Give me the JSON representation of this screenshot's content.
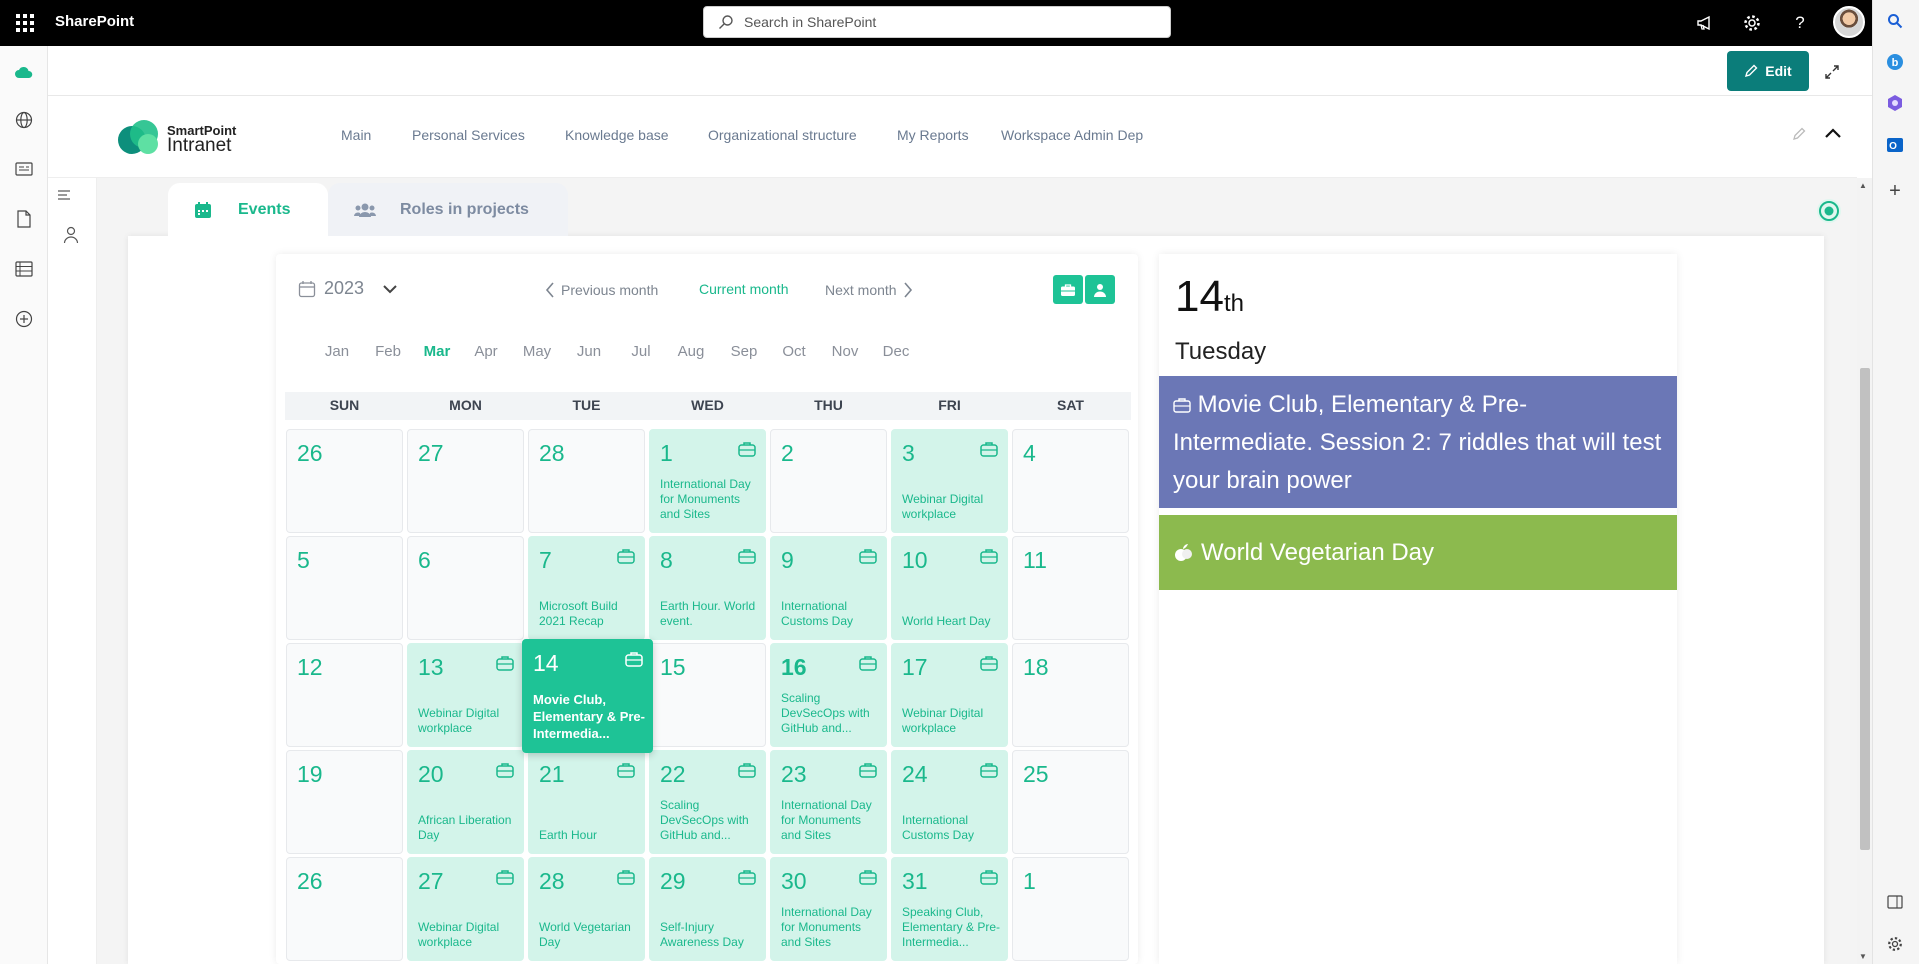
{
  "suitebar": {
    "brand": "SharePoint",
    "search_placeholder": "Search in SharePoint"
  },
  "command": {
    "edit_label": "Edit"
  },
  "nav": {
    "items": [
      "Main",
      "Personal Services",
      "Knowledge base",
      "Organizational structure",
      "My Reports",
      "Workspace Admin Dep"
    ]
  },
  "logo": {
    "line1": "SmartPoint",
    "line2": "Intranet"
  },
  "tabs": [
    {
      "label": "Events",
      "active": true
    },
    {
      "label": "Roles in projects",
      "active": false
    }
  ],
  "calendar": {
    "year": "2023",
    "prev_label": "Previous month",
    "current_label": "Current month",
    "next_label": "Next month",
    "months": [
      "Jan",
      "Feb",
      "Mar",
      "Apr",
      "May",
      "Jun",
      "Jul",
      "Aug",
      "Sep",
      "Oct",
      "Nov",
      "Dec"
    ],
    "selected_month": "Mar",
    "weekdays": [
      "SUN",
      "MON",
      "TUE",
      "WED",
      "THU",
      "FRI",
      "SAT"
    ],
    "weeks": [
      [
        {
          "day": "26",
          "event": ""
        },
        {
          "day": "27",
          "event": ""
        },
        {
          "day": "28",
          "event": ""
        },
        {
          "day": "1",
          "event": "International Day for Monuments and Sites"
        },
        {
          "day": "2",
          "event": ""
        },
        {
          "day": "3",
          "event": "Webinar Digital workplace"
        },
        {
          "day": "4",
          "event": ""
        }
      ],
      [
        {
          "day": "5",
          "event": ""
        },
        {
          "day": "6",
          "event": ""
        },
        {
          "day": "7",
          "event": "Microsoft Build 2021 Recap"
        },
        {
          "day": "8",
          "event": "Earth Hour. World event."
        },
        {
          "day": "9",
          "event": "International Customs Day"
        },
        {
          "day": "10",
          "event": "World Heart Day"
        },
        {
          "day": "11",
          "event": ""
        }
      ],
      [
        {
          "day": "12",
          "event": ""
        },
        {
          "day": "13",
          "event": "Webinar Digital workplace"
        },
        {
          "day": "14",
          "event": "Movie Club, Elementary & Pre-Intermedia...",
          "selected": true
        },
        {
          "day": "15",
          "event": ""
        },
        {
          "day": "16",
          "event": "Scaling DevSecOps with GitHub and...",
          "bold": true
        },
        {
          "day": "17",
          "event": "Webinar Digital workplace"
        },
        {
          "day": "18",
          "event": ""
        }
      ],
      [
        {
          "day": "19",
          "event": ""
        },
        {
          "day": "20",
          "event": "African Liberation Day"
        },
        {
          "day": "21",
          "event": "Earth Hour"
        },
        {
          "day": "22",
          "event": "Scaling DevSecOps with GitHub and..."
        },
        {
          "day": "23",
          "event": "International Day for Monuments and Sites"
        },
        {
          "day": "24",
          "event": "International Customs Day"
        },
        {
          "day": "25",
          "event": ""
        }
      ],
      [
        {
          "day": "26",
          "event": ""
        },
        {
          "day": "27",
          "event": "Webinar Digital workplace"
        },
        {
          "day": "28",
          "event": "World Vegetarian Day"
        },
        {
          "day": "29",
          "event": "Self-Injury Awareness Day"
        },
        {
          "day": "30",
          "event": "International Day for Monuments and Sites"
        },
        {
          "day": "31",
          "event": "Speaking Club, Elementary & Pre-Intermedia..."
        },
        {
          "day": "1",
          "event": ""
        }
      ]
    ]
  },
  "detail": {
    "day_number": "14",
    "day_suffix": "th",
    "weekday": "Tuesday",
    "events": [
      {
        "title": "Movie Club, Elementary & Pre-Intermediate. Session 2: 7 riddles that will test your brain power",
        "color": "#6b77b6"
      },
      {
        "title": "World Vegetarian Day",
        "color": "#8cba4e"
      }
    ]
  },
  "colors": {
    "accent": "#1ab88c",
    "edit_button": "#0b7d7a"
  }
}
